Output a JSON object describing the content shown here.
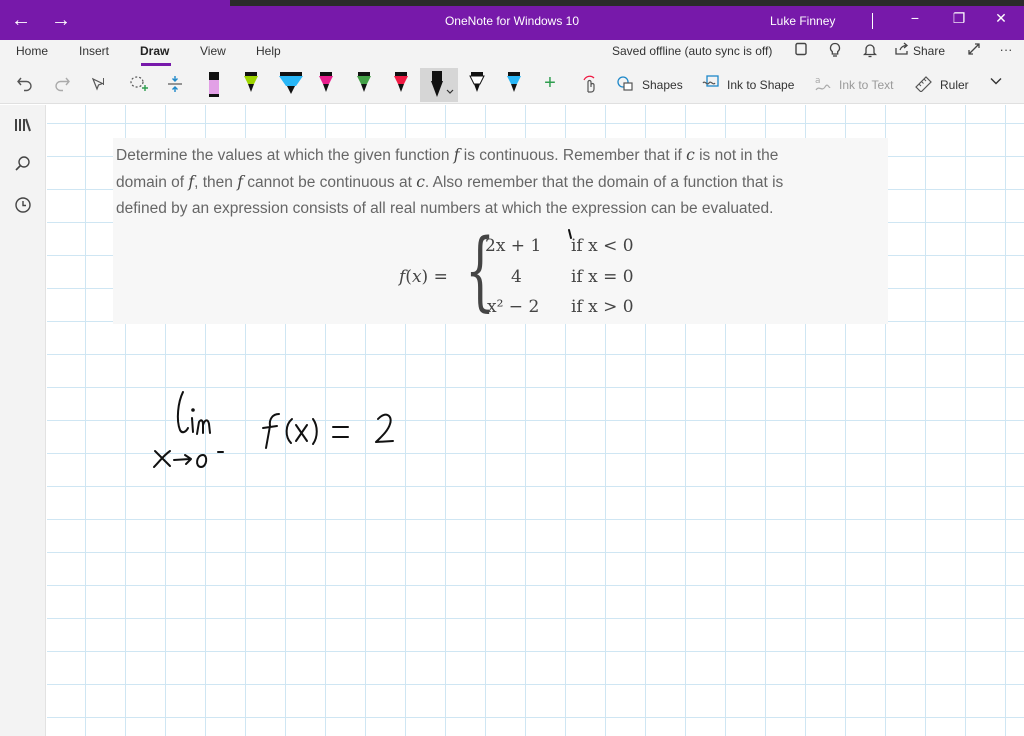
{
  "window": {
    "title": "OneNote for Windows 10",
    "user": "Luke Finney",
    "back_glyph": "←",
    "forward_glyph": "→",
    "minimize_glyph": "−",
    "restore_glyph": "❐",
    "close_glyph": "✕"
  },
  "menu": {
    "tabs": [
      {
        "label": "Home"
      },
      {
        "label": "Insert"
      },
      {
        "label": "Draw",
        "active": true
      },
      {
        "label": "View"
      },
      {
        "label": "Help"
      }
    ],
    "status": "Saved offline (auto sync is off)",
    "share_label": "Share",
    "more_glyph": "···"
  },
  "toolbar": {
    "shapes_label": "Shapes",
    "ink_to_shape_label": "Ink to Shape",
    "ink_to_text_label": "Ink to Text",
    "ruler_label": "Ruler",
    "add_glyph": "+",
    "chevron_glyph": "⌄",
    "pens": [
      {
        "color": "#e2a0e6",
        "kind": "highlighter"
      },
      {
        "color": "#9dd400",
        "kind": "pen"
      },
      {
        "color": "#29b6f6",
        "kind": "highlighter"
      },
      {
        "color": "#e91e8c",
        "kind": "pen"
      },
      {
        "color": "#43a047",
        "kind": "pen"
      },
      {
        "color": "#ef1a43",
        "kind": "pen"
      },
      {
        "color": "#111111",
        "kind": "pen",
        "selected": true
      },
      {
        "color": "#333333",
        "kind": "pen"
      },
      {
        "color": "#29b6f6",
        "kind": "pen"
      }
    ]
  },
  "problem": {
    "line1_a": "Determine the values at which the given function ",
    "line1_f": "f",
    "line1_b": " is continuous. Remember that if ",
    "line1_c": "c",
    "line1_d": " is not in the",
    "line2_a": "domain of ",
    "line2_f": "f",
    "line2_b": ", then ",
    "line2_f2": "f",
    "line2_c": " cannot be continuous at ",
    "line2_cc": "c",
    "line2_d": ". Also remember that the domain of a function that is",
    "line3": "defined by an expression consists of all real numbers at which the expression can be evaluated.",
    "lhs_f": "f",
    "lhs_open": "(",
    "lhs_x": "x",
    "lhs_close": ") =",
    "brace": "{",
    "cases": [
      {
        "expr": "2x + 1",
        "cond": "if x < 0"
      },
      {
        "expr": "4",
        "cond": "if x = 0"
      },
      {
        "expr": "x² − 2",
        "cond": "if x > 0"
      }
    ]
  },
  "ink": {
    "color": "#111111"
  }
}
